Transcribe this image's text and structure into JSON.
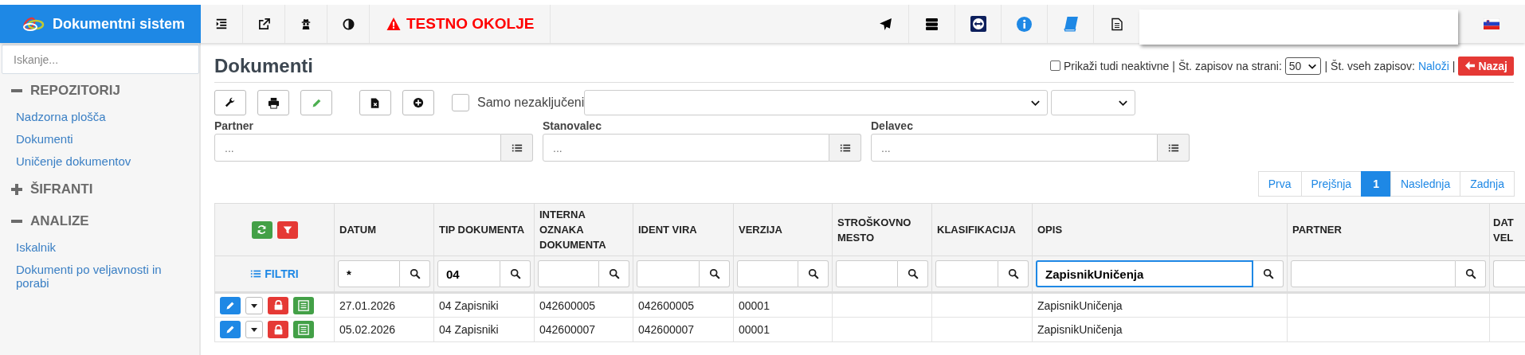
{
  "brand": {
    "title": "Dokumentni sistem"
  },
  "topbar": {
    "warning": "TESTNO OKOLJE"
  },
  "sidebar": {
    "search": {
      "placeholder": "Iskanje..."
    },
    "sections": [
      {
        "title": "REPOZITORIJ",
        "expanded": true,
        "items": [
          "Nadzorna plošča",
          "Dokumenti",
          "Uničenje dokumentov"
        ]
      },
      {
        "title": "ŠIFRANTI",
        "expanded": false
      },
      {
        "title": "ANALIZE",
        "expanded": true,
        "items": [
          "Iskalnik",
          "Dokumenti po veljavnosti in porabi"
        ]
      }
    ]
  },
  "page": {
    "title": "Dokumenti",
    "show_inactive": {
      "label": "Prikaži tudi neaktivne",
      "checked": false
    },
    "sep_1": "|",
    "per_page_label": "Št. zapisov na strani:",
    "per_page": "50",
    "sep_2": "|",
    "total_label": "Št. vseh zapisov:",
    "load_link": "Naloži",
    "sep_3": "|",
    "back_button": "Nazaj"
  },
  "toolbar": {
    "only_unfinished": {
      "label": "Samo nezaključeni",
      "checked": false
    }
  },
  "filters": [
    {
      "label": "Partner",
      "placeholder": "..."
    },
    {
      "label": "Stanovalec",
      "placeholder": "..."
    },
    {
      "label": "Delavec",
      "placeholder": "..."
    }
  ],
  "pagination": [
    {
      "label": "Prva",
      "selected": false
    },
    {
      "label": "Prejšnja",
      "selected": false
    },
    {
      "label": "1",
      "selected": true
    },
    {
      "label": "Naslednja",
      "selected": false
    },
    {
      "label": "Zadnja",
      "selected": false
    }
  ],
  "table": {
    "filters_label": "FILTRI",
    "columns": [
      {
        "label": "DATUM",
        "filter": "*",
        "focused": false
      },
      {
        "label": "TIP DOKUMENTA",
        "filter": "04",
        "focused": false
      },
      {
        "label": "INTERNA OZNAKA DOKUMENTA",
        "focused": false
      },
      {
        "label": "IDENT VIRA",
        "focused": false
      },
      {
        "label": "VERZIJA",
        "focused": false
      },
      {
        "label": "STROŠKOVNO MESTO",
        "focused": false
      },
      {
        "label": "KLASIFIKACIJA",
        "focused": false
      },
      {
        "label": "OPIS",
        "filter": "ZapisnikUničenja",
        "focused": true
      },
      {
        "label": "PARTNER",
        "focused": false
      },
      {
        "label": "DAT VEL",
        "focused": false
      }
    ],
    "rows": [
      {
        "cells": [
          "27.01.2026",
          "04 Zapisniki",
          "042600005",
          "042600005",
          "00001",
          "",
          "",
          "ZapisnikUničenja",
          "",
          ""
        ]
      },
      {
        "cells": [
          "05.02.2026",
          "04 Zapisniki",
          "042600007",
          "042600007",
          "00001",
          "",
          "",
          "ZapisnikUničenja",
          "",
          ""
        ]
      }
    ]
  }
}
